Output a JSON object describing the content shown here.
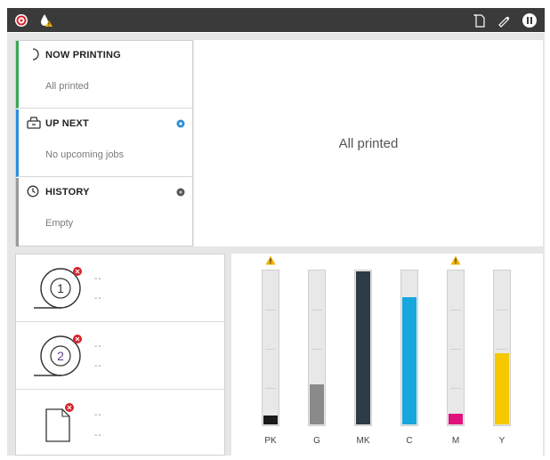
{
  "topbar": {
    "left_icons": [
      "hp-connect-icon",
      "ink-drop-warning-icon"
    ],
    "right_icons": [
      "paper-load-icon",
      "pen-icon",
      "pause-icon"
    ]
  },
  "jobs": {
    "now_printing": {
      "title": "NOW PRINTING",
      "status": "All printed",
      "icon": "spinner-icon",
      "accent": "#3aa655"
    },
    "up_next": {
      "title": "UP NEXT",
      "status": "No upcoming jobs",
      "icon": "printer-queue-icon",
      "accent": "#2b8ed8"
    },
    "history": {
      "title": "HISTORY",
      "status": "Empty",
      "icon": "clock-icon",
      "accent": "#9a9a9a"
    }
  },
  "preview": {
    "text": "All printed"
  },
  "media": {
    "rolls": [
      {
        "number": "1",
        "line1": "--",
        "line2": "--",
        "error": true
      },
      {
        "number": "2",
        "line1": "--",
        "line2": "--",
        "error": true
      }
    ],
    "sheet": {
      "line1": "--",
      "line2": "--",
      "error": true
    }
  },
  "ink": {
    "cartridges": [
      {
        "label": "PK",
        "level": 0.06,
        "color": "#1a1a1a",
        "warning": true
      },
      {
        "label": "G",
        "level": 0.26,
        "color": "#8a8a8a",
        "warning": false
      },
      {
        "label": "MK",
        "level": 0.99,
        "color": "#2e3a46",
        "warning": false
      },
      {
        "label": "C",
        "level": 0.82,
        "color": "#18a7dd",
        "warning": false
      },
      {
        "label": "M",
        "level": 0.07,
        "color": "#e0137c",
        "warning": true
      },
      {
        "label": "Y",
        "level": 0.46,
        "color": "#f5c800",
        "warning": false
      }
    ]
  }
}
